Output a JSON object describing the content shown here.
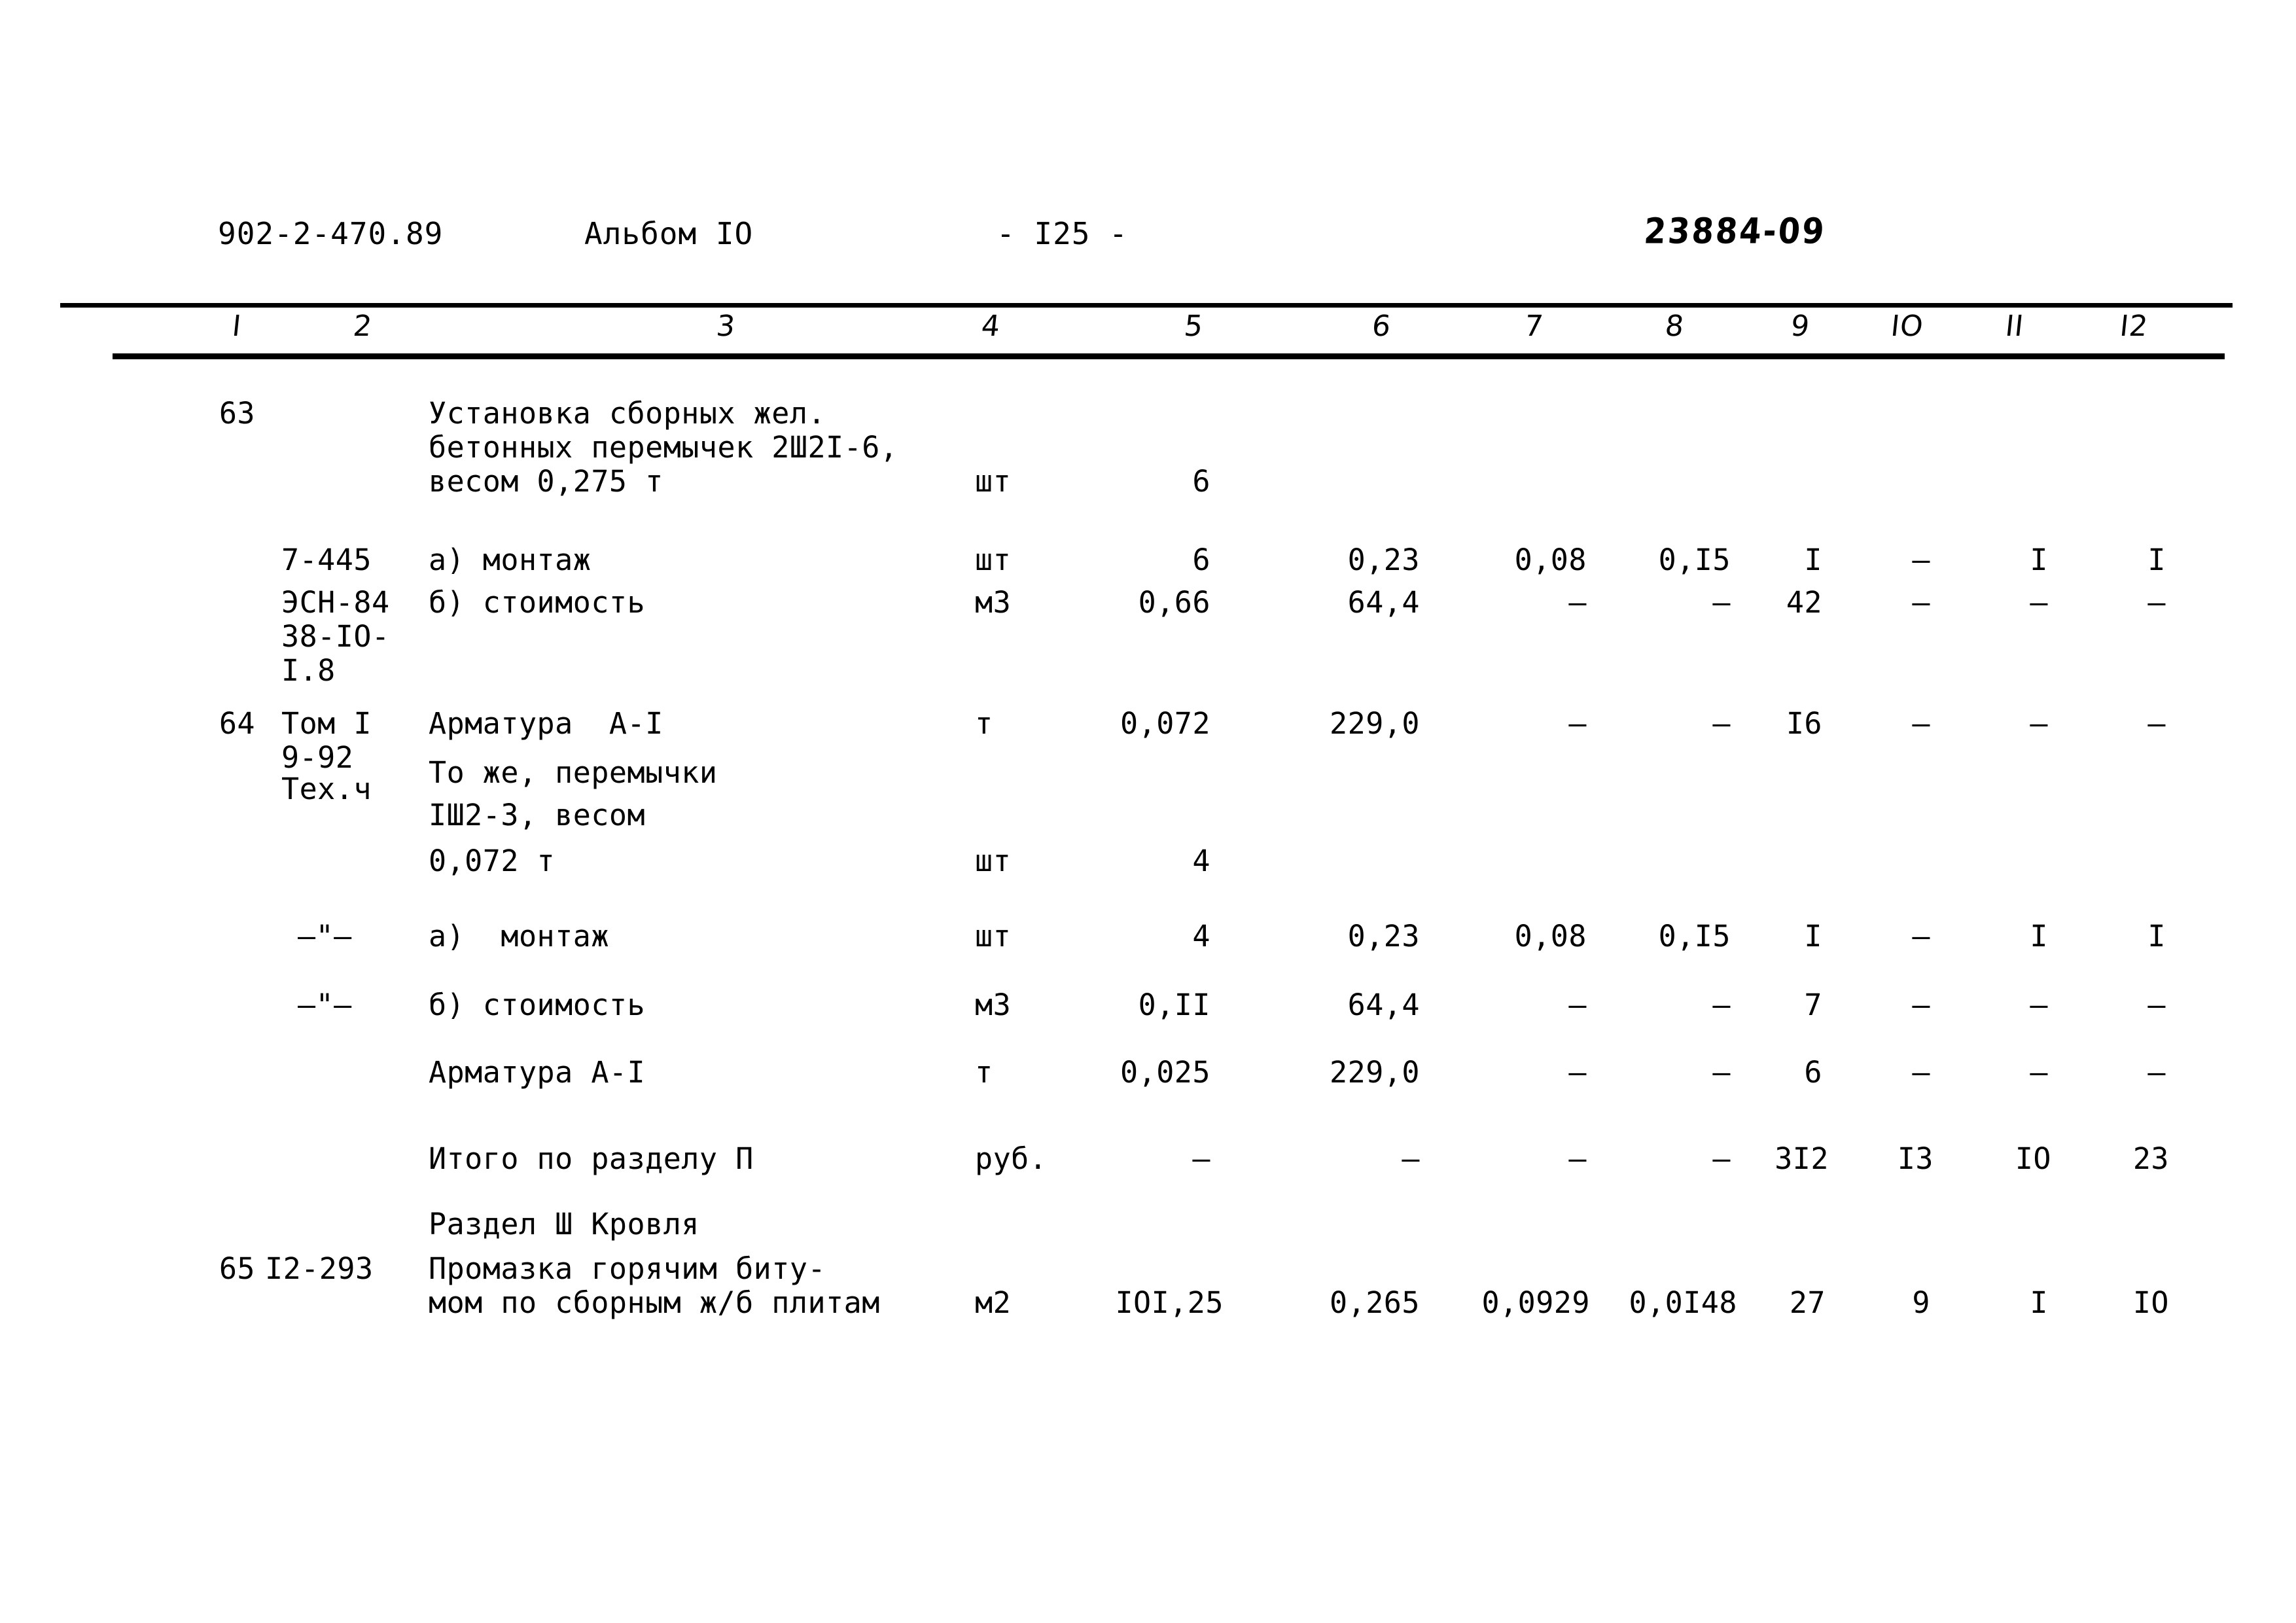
{
  "header": {
    "doc_code": "902-2-470.89",
    "album": "Альбом IO",
    "page_number": "- I25 -",
    "stamp": "23884-09"
  },
  "table": {
    "column_headers": [
      "I",
      "2",
      "3",
      "4",
      "5",
      "6",
      "7",
      "8",
      "9",
      "IO",
      "II",
      "I2"
    ],
    "rows": [
      {
        "no": "63",
        "code": "",
        "desc_lines": [
          "Установка сборных жел.",
          "бетонных перемычек 2Ш2I-6,",
          "весом 0,275 т"
        ],
        "unit": "шт",
        "c5": "6",
        "c6": "",
        "c7": "",
        "c8": "",
        "c9": "",
        "c10": "",
        "c11": "",
        "c12": ""
      },
      {
        "no": "",
        "code": "7-445",
        "desc_lines": [
          "а) монтаж"
        ],
        "unit": "шт",
        "c5": "6",
        "c6": "0,23",
        "c7": "0,08",
        "c8": "0,I5",
        "c9": "I",
        "c10": "–",
        "c11": "I",
        "c12": "I"
      },
      {
        "no": "",
        "code": "ЭСН-84",
        "code_extra": [
          "38-IO-",
          "I.8"
        ],
        "desc_lines": [
          "б) стоимость"
        ],
        "unit": "м3",
        "c5": "0,66",
        "c6": "64,4",
        "c7": "–",
        "c8": "–",
        "c9": "42",
        "c10": "–",
        "c11": "–",
        "c12": "–"
      },
      {
        "no": "64",
        "code": "Том I",
        "code_extra": [
          "9-92",
          "Тех.ч"
        ],
        "desc_lines": [
          "Арматура  А-I"
        ],
        "unit": "т",
        "c5": "0,072",
        "c6": "229,0",
        "c7": "–",
        "c8": "–",
        "c9": "I6",
        "c10": "–",
        "c11": "–",
        "c12": "–"
      },
      {
        "no": "",
        "code": "",
        "desc_lines": [
          "То же, перемычки",
          "IШ2-3, весом",
          "0,072 т"
        ],
        "unit": "шт",
        "c5": "4",
        "c6": "",
        "c7": "",
        "c8": "",
        "c9": "",
        "c10": "",
        "c11": "",
        "c12": ""
      },
      {
        "no": "",
        "code": "–\"–",
        "desc_lines": [
          "а)  монтаж"
        ],
        "unit": "шт",
        "c5": "4",
        "c6": "0,23",
        "c7": "0,08",
        "c8": "0,I5",
        "c9": "I",
        "c10": "–",
        "c11": "I",
        "c12": "I"
      },
      {
        "no": "",
        "code": "–\"–",
        "desc_lines": [
          "б) стоимость"
        ],
        "unit": "м3",
        "c5": "0,II",
        "c6": "64,4",
        "c7": "–",
        "c8": "–",
        "c9": "7",
        "c10": "–",
        "c11": "–",
        "c12": "–"
      },
      {
        "no": "",
        "code": "",
        "desc_lines": [
          "Арматура А-I"
        ],
        "unit": "т",
        "c5": "0,025",
        "c6": "229,0",
        "c7": "–",
        "c8": "–",
        "c9": "6",
        "c10": "–",
        "c11": "–",
        "c12": "–"
      },
      {
        "no": "",
        "code": "",
        "desc_lines": [
          "Итого по разделу П"
        ],
        "unit": "руб.",
        "c5": "–",
        "c6": "–",
        "c7": "–",
        "c8": "–",
        "c9": "3I2",
        "c10": "I3",
        "c11": "IO",
        "c12": "23"
      },
      {
        "no": "",
        "code": "",
        "desc_lines": [
          "Раздел Ш Кровля"
        ],
        "unit": "",
        "c5": "",
        "c6": "",
        "c7": "",
        "c8": "",
        "c9": "",
        "c10": "",
        "c11": "",
        "c12": ""
      },
      {
        "no": "65",
        "code": "I2-293",
        "desc_lines": [
          "Промазка горячим биту-",
          "мом по сборным ж/б плитам"
        ],
        "unit": "м2",
        "c5": "IOI,25",
        "c6": "0,265",
        "c7": "0,0929",
        "c8": "0,0I48",
        "c9": "27",
        "c10": "9",
        "c11": "I",
        "c12": "IO"
      }
    ]
  }
}
